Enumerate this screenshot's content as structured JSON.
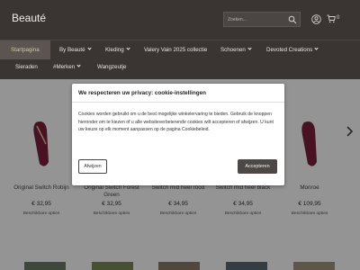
{
  "header": {
    "logo": "Beauté",
    "search_placeholder": "Zoeken...",
    "cart_count": "0"
  },
  "nav": {
    "row1": [
      {
        "label": "Startpagina",
        "dropdown": false,
        "active": true
      },
      {
        "label": "By Beauté",
        "dropdown": true
      },
      {
        "label": "Kleding",
        "dropdown": true
      },
      {
        "label": "Valery Vain 2025 collectie",
        "dropdown": false
      },
      {
        "label": "Schoenen",
        "dropdown": true
      },
      {
        "label": "Devoted Creations",
        "dropdown": true
      }
    ],
    "row2": [
      {
        "label": "Sieraden",
        "dropdown": false
      },
      {
        "label": "#Merken",
        "dropdown": true
      },
      {
        "label": "Wangzeutje",
        "dropdown": false
      }
    ]
  },
  "products": [
    {
      "name": "Original Switch Robijn",
      "price": "€ 32,95",
      "options": "Beschikbare opties"
    },
    {
      "name": "Original Switch Forest Green",
      "price": "€ 32,95",
      "options": "Beschikbare opties"
    },
    {
      "name": "Switch mid heel rood",
      "price": "€ 34,95",
      "options": "Beschikbare opties"
    },
    {
      "name": "Switch mid heel black",
      "price": "€ 34,95",
      "options": "Beschikbare opties"
    },
    {
      "name": "Monroe",
      "price": "€ 109,95",
      "options": "Beschikbare opties"
    }
  ],
  "cookie_modal": {
    "title": "We respecteren uw privacy: cookie-instellingen",
    "text": "Cookies worden gebruikt om u de best mogelijke winkelervaring te bieden. Gebruik de knoppen hieronder om te kiezen of u alle websiteverbeterende cookies wilt accepteren of afwijzen. U kunt uw keuze op elk moment aanpassen op de pagina Cookiebeleid.",
    "reject_label": "Afwijzen",
    "accept_label": "Accepteren"
  },
  "icons": {
    "search": "search-icon",
    "user": "user-icon",
    "cart": "cart-icon",
    "slider_next": "chevron-right-icon"
  },
  "colors": {
    "header_bg": "#3a3533",
    "accept_button": "#4d4846",
    "product_color": "#7a1f3a"
  }
}
